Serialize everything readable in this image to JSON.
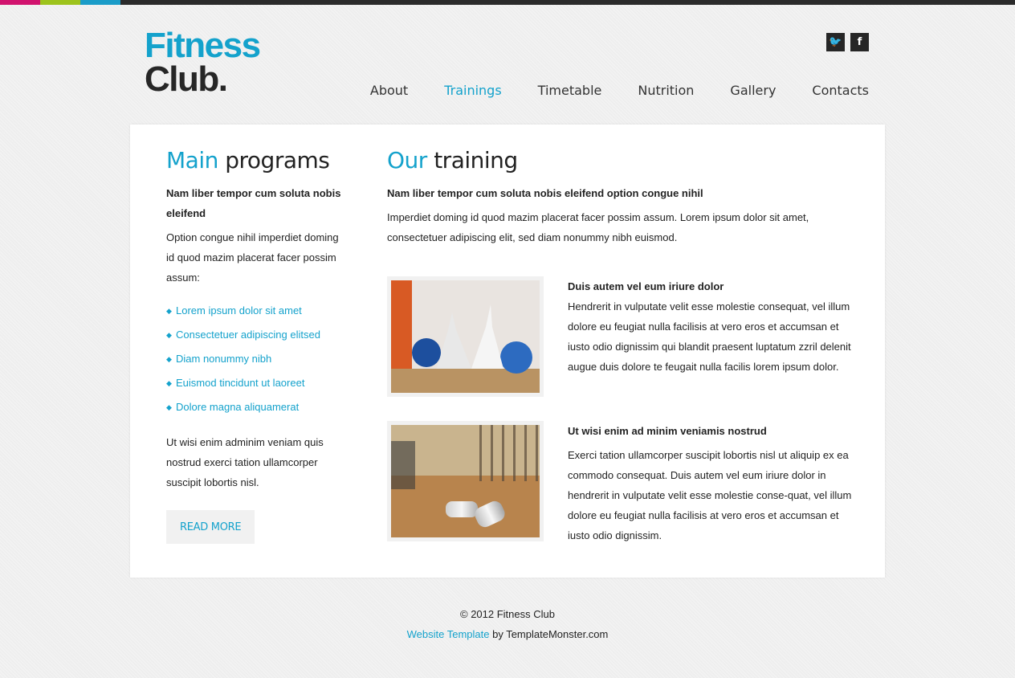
{
  "brand": {
    "line1": "Fitness",
    "line2": "Club."
  },
  "colors": {
    "accent": "#14a2cc",
    "stripe_pink": "#d1136e",
    "stripe_green": "#9dc31c",
    "stripe_blue": "#1a9cc8"
  },
  "social": [
    {
      "name": "twitter-icon",
      "glyph": "🐦"
    },
    {
      "name": "facebook-icon",
      "glyph": "f"
    }
  ],
  "nav": {
    "items": [
      {
        "label": "About",
        "active": false
      },
      {
        "label": "Trainings",
        "active": true
      },
      {
        "label": "Timetable",
        "active": false
      },
      {
        "label": "Nutrition",
        "active": false
      },
      {
        "label": "Gallery",
        "active": false
      },
      {
        "label": "Contacts",
        "active": false
      }
    ]
  },
  "left": {
    "title_accent": "Main",
    "title_rest": "programs",
    "lead": "Nam liber tempor cum soluta nobis eleifend",
    "intro": "Option congue nihil imperdiet doming id quod mazim placerat facer possim assum:",
    "list": [
      "Lorem ipsum dolor sit amet",
      "Consectetuer adipiscing elitsed",
      "Diam nonummy nibh",
      "Euismod tincidunt ut laoreet",
      "Dolore magna aliquamerat"
    ],
    "outro": "Ut wisi enim adminim veniam quis nostrud exerci tation ullamcorper suscipit lobortis nisl.",
    "button": "READ MORE"
  },
  "right": {
    "title_accent": "Our",
    "title_rest": "training",
    "lead": "Nam liber tempor cum soluta nobis eleifend option congue nihil",
    "intro": "Imperdiet doming id quod mazim placerat facer possim assum. Lorem ipsum dolor sit amet, consectetuer adipiscing elit, sed diam nonummy nibh euismod.",
    "items": [
      {
        "heading": "Duis autem vel eum iriure dolor",
        "text": "Hendrerit in vulputate velit esse molestie consequat, vel illum dolore eu feugiat nulla facilisis at vero eros et accumsan et iusto odio dignissim qui blandit praesent luptatum zzril delenit augue duis dolore te feugait nulla facilis lorem ipsum dolor."
      },
      {
        "heading": "Ut wisi enim ad minim veniamis nostrud",
        "text": "Exerci tation ullamcorper suscipit lobortis nisl ut aliquip ex ea commodo consequat. Duis autem vel eum iriure dolor in hendrerit in vulputate velit esse molestie conse-quat, vel illum dolore eu feugiat nulla facilisis at vero eros et accumsan et iusto odio dignissim."
      }
    ]
  },
  "footer": {
    "copyright": "© 2012 Fitness Club",
    "link": "Website Template",
    "by": " by TemplateMonster.com"
  }
}
